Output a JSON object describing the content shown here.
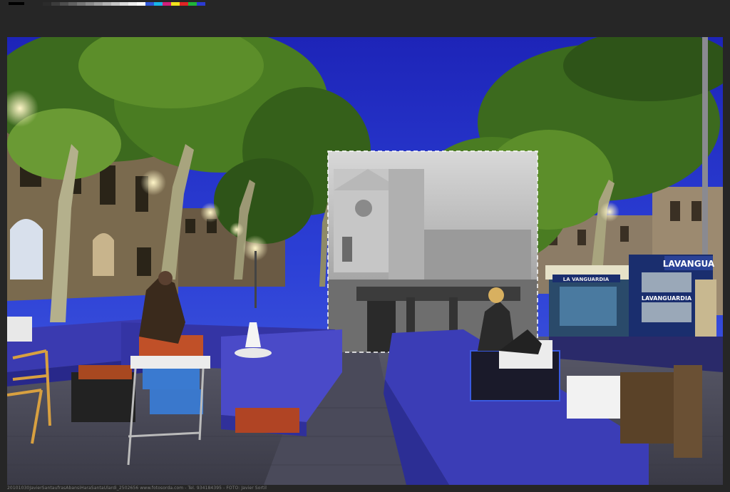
{
  "swatches": [
    "#2b2b2b",
    "#3c3c3c",
    "#4e4e4e",
    "#616161",
    "#767676",
    "#8a8a8a",
    "#9e9e9e",
    "#b2b2b2",
    "#c6c6c6",
    "#dadada",
    "#ededed",
    "#ffffff",
    "#2f57d8",
    "#18b6e8",
    "#d11f7b",
    "#f2e21c",
    "#e02424",
    "#1fb53a",
    "#2b3bd1"
  ],
  "photo": {
    "signs": {
      "awning_right": "LAVANGUA",
      "kiosk_banner": "LA VANGUARDIA",
      "kiosk_window": "LAVANGUARDIA"
    }
  },
  "caption": "20101030JavierSantaufrasAbansiHaraSantaUlardi_2502656  www.fotosorda.com - Tel. 934184395 - FOTO: Javier Sortil"
}
